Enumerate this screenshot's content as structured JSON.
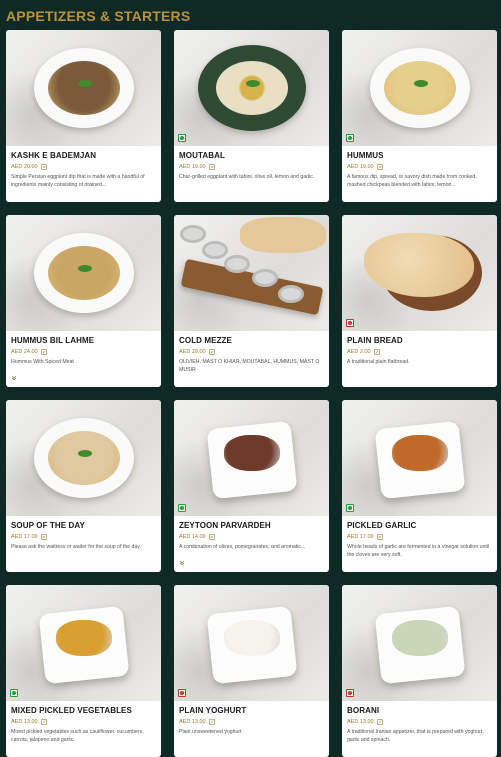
{
  "section": {
    "title": "APPETIZERS & STARTERS"
  },
  "colors": {
    "background": "#0f2a25",
    "accent": "#b7933f",
    "veg": "#2e9a3a",
    "nonveg": "#c0392b"
  },
  "items": [
    {
      "name": "KASHK E BADEMJAN",
      "price": "AED 20.00",
      "desc": "Simple Persian eggplant dip that is made with a handful of ingredients mainly consisting of drained...",
      "marker": "none",
      "food_color": "#7a5a3a",
      "style": "plate"
    },
    {
      "name": "MOUTABAL",
      "price": "AED 19.00",
      "desc": "Char-grilled eggplant with tahini, olive oil, lemon and garlic.",
      "marker": "veg",
      "food_color": "#e8dfc4",
      "style": "green-plate"
    },
    {
      "name": "HUMMUS",
      "price": "AED 19.00",
      "desc": "A famous dip, spread, or savory dish made from cooked, mashed chickpeas blended with tahini, lemon...",
      "marker": "veg",
      "food_color": "#e6cf8a",
      "style": "plate"
    },
    {
      "name": "HUMMUS BIL LAHME",
      "price": "AED 24.00",
      "desc": "Hummus With Spiced Meat",
      "marker": "expand",
      "food_color": "#c9a664",
      "style": "plate"
    },
    {
      "name": "COLD MEZZE",
      "price": "AED 29.00",
      "desc": "OLIVIEH, MAST O KHIAR, MOUTABAL, HUMMUS, MAST O MUSIR",
      "marker": "none",
      "food_color": "#8a5a30",
      "style": "board"
    },
    {
      "name": "PLAIN BREAD",
      "price": "AED 2.00",
      "desc": "A traditional plain flatbread.",
      "marker": "nonveg",
      "food_color": "#e4c89a",
      "style": "bread"
    },
    {
      "name": "SOUP OF THE DAY",
      "price": "AED 17.00",
      "desc": "Please ask the waitress or waiter for the soup of the day.",
      "marker": "none",
      "food_color": "#e0c9a0",
      "style": "plate"
    },
    {
      "name": "ZEYTOON PARVARDEH",
      "price": "AED 14.00",
      "desc": "A combination of olives, pomegranates, and aromatic...",
      "marker": "veg-expand",
      "food_color": "#6e3a2a",
      "style": "square"
    },
    {
      "name": "PICKLED GARLIC",
      "price": "AED 17.00",
      "desc": "Whole heads of garlic are fermented in a vinegar solution until the cloves are very soft.",
      "marker": "veg",
      "food_color": "#c06a2a",
      "style": "square"
    },
    {
      "name": "MIXED PICKLED VEGETABLES",
      "price": "AED 13.00",
      "desc": "Mixed pickled vegetables such as cauliflower, cucumbers, carrots, jalapeno and garlic.",
      "marker": "veg",
      "food_color": "#d8a030",
      "style": "square"
    },
    {
      "name": "PLAIN YOGHURT",
      "price": "AED 13.00",
      "desc": "Plain unsweetened yoghurt",
      "marker": "nonveg",
      "food_color": "#f5f3ec",
      "style": "square"
    },
    {
      "name": "BORANI",
      "price": "AED 13.00",
      "desc": "A traditional Iranian appetizer, that is prepared with yoghurt, garlic and spinach.",
      "marker": "nonveg",
      "food_color": "#c9d6b8",
      "style": "square"
    }
  ]
}
